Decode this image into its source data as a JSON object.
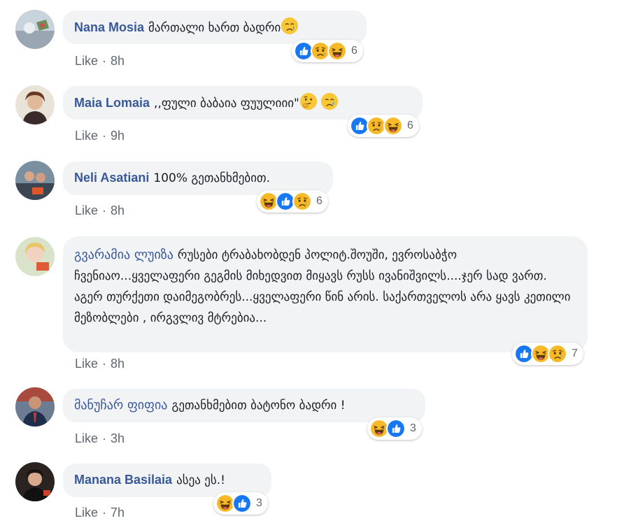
{
  "comments": [
    {
      "author": "Nana Mosia",
      "text": "მართალი ხართ ბადრი",
      "inline_emojis": [
        "crying-face"
      ],
      "like_label": "Like",
      "time": "8h",
      "reactions": [
        "like",
        "sad",
        "haha"
      ],
      "reaction_count": "6"
    },
    {
      "author": "Maia Lomaia",
      "text": ",,ფული ბაბაია ფუულიიი\"",
      "inline_emojis": [
        "thinking-face",
        "crying-face"
      ],
      "like_label": "Like",
      "time": "9h",
      "reactions": [
        "like",
        "sad",
        "haha"
      ],
      "reaction_count": "6"
    },
    {
      "author": "Neli Asatiani",
      "text": "100% გეთანხმებით.",
      "inline_emojis": [],
      "like_label": "Like",
      "time": "8h",
      "reactions": [
        "haha",
        "like",
        "sad"
      ],
      "reaction_count": "6"
    },
    {
      "author": "გვარამია ლუიზა",
      "text": "რუსები ტრაბახობდენ პოლიტ.შოუში, ევროსაბჭო ჩვენიაო...ყველაფერი გეგმის მიხედვით მიყავს რუსს ივანიშვილს....ჯერ სად ვართ. აგერ თურქეთი დაიმეგობრეს...ყველაფერი წინ არის. საქართველოს არა ყავს კეთილი მეზობლები , ირგვლივ მტრებია...",
      "inline_emojis": [],
      "like_label": "Like",
      "time": "8h",
      "reactions": [
        "like",
        "haha",
        "sad"
      ],
      "reaction_count": "7"
    },
    {
      "author": "მანუჩარ ფიფია",
      "text": "გეთანხმებით ბატონო ბადრი !",
      "inline_emojis": [],
      "like_label": "Like",
      "time": "3h",
      "reactions": [
        "haha",
        "like"
      ],
      "reaction_count": "3"
    },
    {
      "author": "Manana Basilaia",
      "text": "ასეა ეს.!",
      "inline_emojis": [],
      "like_label": "Like",
      "time": "7h",
      "reactions": [
        "haha",
        "like"
      ],
      "reaction_count": "3"
    }
  ],
  "colors": {
    "author": "#385898",
    "bubble": "#f2f3f5",
    "meta": "#606770",
    "like_blue": "#1877f2",
    "emoji_yellow": "#f7b928"
  }
}
